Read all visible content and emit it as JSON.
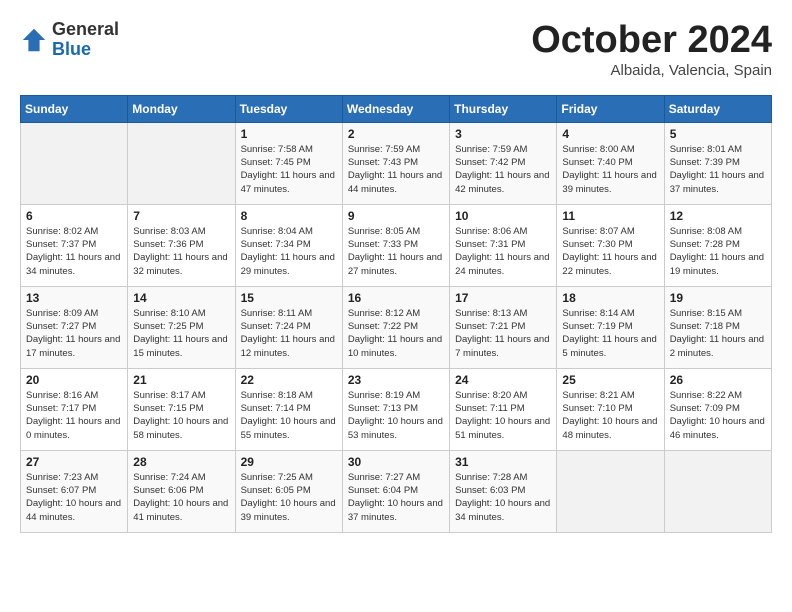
{
  "header": {
    "logo_general": "General",
    "logo_blue": "Blue",
    "title": "October 2024",
    "subtitle": "Albaida, Valencia, Spain"
  },
  "weekdays": [
    "Sunday",
    "Monday",
    "Tuesday",
    "Wednesday",
    "Thursday",
    "Friday",
    "Saturday"
  ],
  "weeks": [
    [
      {
        "day": "",
        "info": ""
      },
      {
        "day": "",
        "info": ""
      },
      {
        "day": "1",
        "info": "Sunrise: 7:58 AM\nSunset: 7:45 PM\nDaylight: 11 hours and 47 minutes."
      },
      {
        "day": "2",
        "info": "Sunrise: 7:59 AM\nSunset: 7:43 PM\nDaylight: 11 hours and 44 minutes."
      },
      {
        "day": "3",
        "info": "Sunrise: 7:59 AM\nSunset: 7:42 PM\nDaylight: 11 hours and 42 minutes."
      },
      {
        "day": "4",
        "info": "Sunrise: 8:00 AM\nSunset: 7:40 PM\nDaylight: 11 hours and 39 minutes."
      },
      {
        "day": "5",
        "info": "Sunrise: 8:01 AM\nSunset: 7:39 PM\nDaylight: 11 hours and 37 minutes."
      }
    ],
    [
      {
        "day": "6",
        "info": "Sunrise: 8:02 AM\nSunset: 7:37 PM\nDaylight: 11 hours and 34 minutes."
      },
      {
        "day": "7",
        "info": "Sunrise: 8:03 AM\nSunset: 7:36 PM\nDaylight: 11 hours and 32 minutes."
      },
      {
        "day": "8",
        "info": "Sunrise: 8:04 AM\nSunset: 7:34 PM\nDaylight: 11 hours and 29 minutes."
      },
      {
        "day": "9",
        "info": "Sunrise: 8:05 AM\nSunset: 7:33 PM\nDaylight: 11 hours and 27 minutes."
      },
      {
        "day": "10",
        "info": "Sunrise: 8:06 AM\nSunset: 7:31 PM\nDaylight: 11 hours and 24 minutes."
      },
      {
        "day": "11",
        "info": "Sunrise: 8:07 AM\nSunset: 7:30 PM\nDaylight: 11 hours and 22 minutes."
      },
      {
        "day": "12",
        "info": "Sunrise: 8:08 AM\nSunset: 7:28 PM\nDaylight: 11 hours and 19 minutes."
      }
    ],
    [
      {
        "day": "13",
        "info": "Sunrise: 8:09 AM\nSunset: 7:27 PM\nDaylight: 11 hours and 17 minutes."
      },
      {
        "day": "14",
        "info": "Sunrise: 8:10 AM\nSunset: 7:25 PM\nDaylight: 11 hours and 15 minutes."
      },
      {
        "day": "15",
        "info": "Sunrise: 8:11 AM\nSunset: 7:24 PM\nDaylight: 11 hours and 12 minutes."
      },
      {
        "day": "16",
        "info": "Sunrise: 8:12 AM\nSunset: 7:22 PM\nDaylight: 11 hours and 10 minutes."
      },
      {
        "day": "17",
        "info": "Sunrise: 8:13 AM\nSunset: 7:21 PM\nDaylight: 11 hours and 7 minutes."
      },
      {
        "day": "18",
        "info": "Sunrise: 8:14 AM\nSunset: 7:19 PM\nDaylight: 11 hours and 5 minutes."
      },
      {
        "day": "19",
        "info": "Sunrise: 8:15 AM\nSunset: 7:18 PM\nDaylight: 11 hours and 2 minutes."
      }
    ],
    [
      {
        "day": "20",
        "info": "Sunrise: 8:16 AM\nSunset: 7:17 PM\nDaylight: 11 hours and 0 minutes."
      },
      {
        "day": "21",
        "info": "Sunrise: 8:17 AM\nSunset: 7:15 PM\nDaylight: 10 hours and 58 minutes."
      },
      {
        "day": "22",
        "info": "Sunrise: 8:18 AM\nSunset: 7:14 PM\nDaylight: 10 hours and 55 minutes."
      },
      {
        "day": "23",
        "info": "Sunrise: 8:19 AM\nSunset: 7:13 PM\nDaylight: 10 hours and 53 minutes."
      },
      {
        "day": "24",
        "info": "Sunrise: 8:20 AM\nSunset: 7:11 PM\nDaylight: 10 hours and 51 minutes."
      },
      {
        "day": "25",
        "info": "Sunrise: 8:21 AM\nSunset: 7:10 PM\nDaylight: 10 hours and 48 minutes."
      },
      {
        "day": "26",
        "info": "Sunrise: 8:22 AM\nSunset: 7:09 PM\nDaylight: 10 hours and 46 minutes."
      }
    ],
    [
      {
        "day": "27",
        "info": "Sunrise: 7:23 AM\nSunset: 6:07 PM\nDaylight: 10 hours and 44 minutes."
      },
      {
        "day": "28",
        "info": "Sunrise: 7:24 AM\nSunset: 6:06 PM\nDaylight: 10 hours and 41 minutes."
      },
      {
        "day": "29",
        "info": "Sunrise: 7:25 AM\nSunset: 6:05 PM\nDaylight: 10 hours and 39 minutes."
      },
      {
        "day": "30",
        "info": "Sunrise: 7:27 AM\nSunset: 6:04 PM\nDaylight: 10 hours and 37 minutes."
      },
      {
        "day": "31",
        "info": "Sunrise: 7:28 AM\nSunset: 6:03 PM\nDaylight: 10 hours and 34 minutes."
      },
      {
        "day": "",
        "info": ""
      },
      {
        "day": "",
        "info": ""
      }
    ]
  ]
}
